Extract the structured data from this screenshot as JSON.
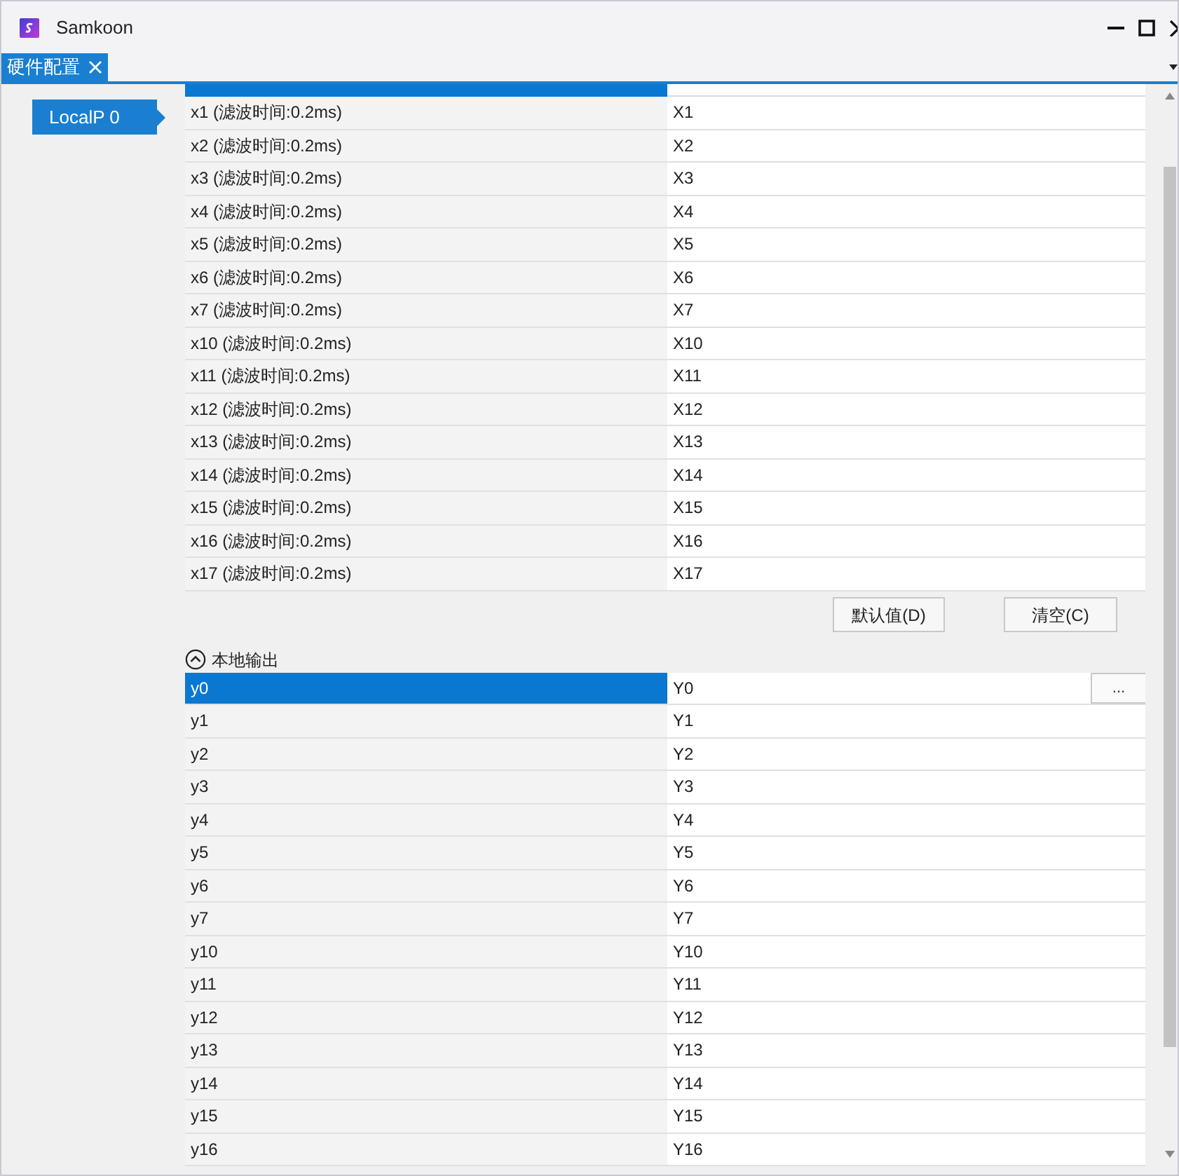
{
  "window": {
    "title": "Samkoon"
  },
  "tabs": [
    {
      "label": "硬件配置",
      "selected": true,
      "closable": true
    }
  ],
  "sidebar": {
    "items": [
      {
        "label": "LocalP 0",
        "selected": true
      }
    ]
  },
  "input_table": {
    "top_row_selected": true,
    "rows": [
      {
        "name": "x1 (滤波时间:0.2ms)",
        "value": "X1",
        "selected": false
      },
      {
        "name": "x2 (滤波时间:0.2ms)",
        "value": "X2",
        "selected": false
      },
      {
        "name": "x3 (滤波时间:0.2ms)",
        "value": "X3",
        "selected": false
      },
      {
        "name": "x4 (滤波时间:0.2ms)",
        "value": "X4",
        "selected": false
      },
      {
        "name": "x5 (滤波时间:0.2ms)",
        "value": "X5",
        "selected": false
      },
      {
        "name": "x6 (滤波时间:0.2ms)",
        "value": "X6",
        "selected": false
      },
      {
        "name": "x7 (滤波时间:0.2ms)",
        "value": "X7",
        "selected": false
      },
      {
        "name": "x10 (滤波时间:0.2ms)",
        "value": "X10",
        "selected": false
      },
      {
        "name": "x11 (滤波时间:0.2ms)",
        "value": "X11",
        "selected": false
      },
      {
        "name": "x12 (滤波时间:0.2ms)",
        "value": "X12",
        "selected": false
      },
      {
        "name": "x13 (滤波时间:0.2ms)",
        "value": "X13",
        "selected": false
      },
      {
        "name": "x14 (滤波时间:0.2ms)",
        "value": "X14",
        "selected": false
      },
      {
        "name": "x15 (滤波时间:0.2ms)",
        "value": "X15",
        "selected": false
      },
      {
        "name": "x16 (滤波时间:0.2ms)",
        "value": "X16",
        "selected": false
      },
      {
        "name": "x17 (滤波时间:0.2ms)",
        "value": "X17",
        "selected": false
      }
    ]
  },
  "buttons": [
    "默认值(D)",
    "清空(C)"
  ],
  "output_section": {
    "title": "本地输出",
    "expanded": true,
    "rows": [
      {
        "name": "y0",
        "value": "Y0",
        "selected": true,
        "browse": "..."
      },
      {
        "name": "y1",
        "value": "Y1",
        "selected": false
      },
      {
        "name": "y2",
        "value": "Y2",
        "selected": false
      },
      {
        "name": "y3",
        "value": "Y3",
        "selected": false
      },
      {
        "name": "y4",
        "value": "Y4",
        "selected": false
      },
      {
        "name": "y5",
        "value": "Y5",
        "selected": false
      },
      {
        "name": "y6",
        "value": "Y6",
        "selected": false
      },
      {
        "name": "y7",
        "value": "Y7",
        "selected": false
      },
      {
        "name": "y10",
        "value": "Y10",
        "selected": false
      },
      {
        "name": "y11",
        "value": "Y11",
        "selected": false
      },
      {
        "name": "y12",
        "value": "Y12",
        "selected": false
      },
      {
        "name": "y13",
        "value": "Y13",
        "selected": false
      },
      {
        "name": "y14",
        "value": "Y14",
        "selected": false
      },
      {
        "name": "y15",
        "value": "Y15",
        "selected": false
      },
      {
        "name": "y16",
        "value": "Y16",
        "selected": false
      }
    ]
  }
}
